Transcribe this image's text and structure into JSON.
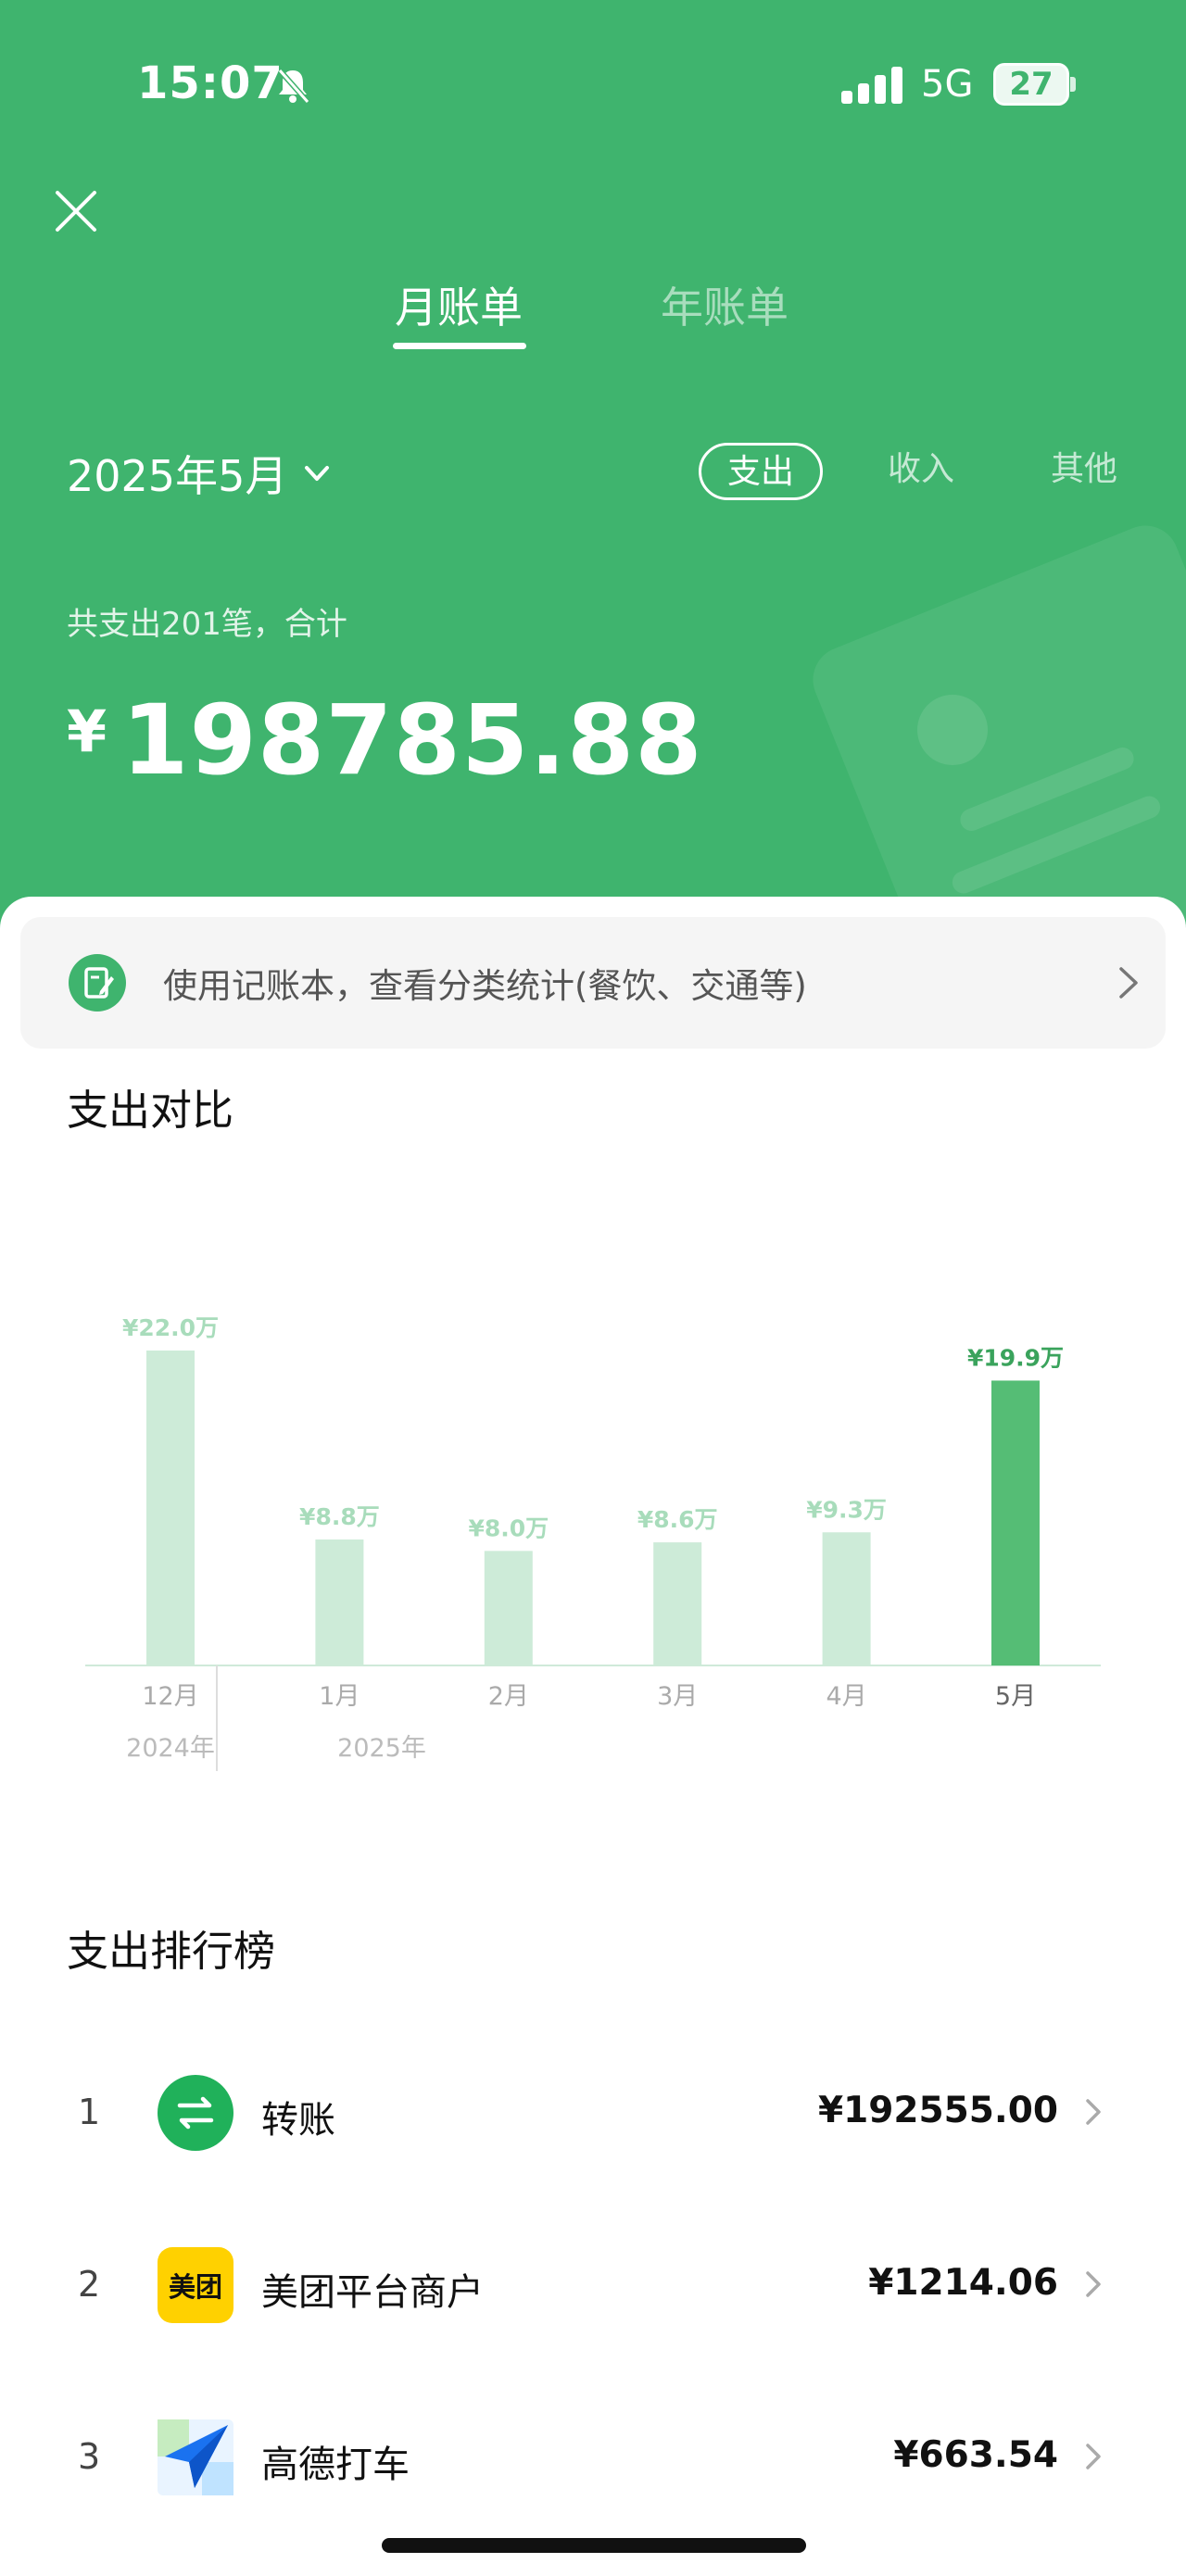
{
  "status_bar": {
    "time": "15:07",
    "network": "5G",
    "battery": "27"
  },
  "header": {
    "tabs": [
      {
        "label": "月账单"
      },
      {
        "label": "年账单"
      }
    ],
    "month_picker": "2025年5月",
    "filters": [
      {
        "label": "支出"
      },
      {
        "label": "收入"
      },
      {
        "label": "其他"
      }
    ],
    "summary_label": "共支出201笔，合计",
    "currency": "¥",
    "total_amount": "198785.88"
  },
  "promo": {
    "text": "使用记账本，查看分类统计(餐饮、交通等)"
  },
  "compare_title": "支出对比",
  "rank_title": "支出排行榜",
  "colors": {
    "brand": "#3fb46e",
    "bar_dim": "#cdebd8",
    "bar_active": "#55bd75",
    "label_dim": "#a8dcbb",
    "label_active": "#3aa35c"
  },
  "chart_data": {
    "type": "bar",
    "categories": [
      "12月",
      "1月",
      "2月",
      "3月",
      "4月",
      "5月"
    ],
    "year_labels": [
      "2024年",
      "2025年"
    ],
    "values": [
      22.0,
      8.8,
      8.0,
      8.6,
      9.3,
      19.9
    ],
    "value_labels": [
      "¥22.0万",
      "¥8.8万",
      "¥8.0万",
      "¥8.6万",
      "¥9.3万",
      "¥19.9万"
    ],
    "highlight_index": 5,
    "unit": "万",
    "ylim": [
      0,
      22.0
    ],
    "grid": false
  },
  "ranking": [
    {
      "rank": "1",
      "name": "转账",
      "amount": "¥192555.00",
      "icon": "transfer-icon"
    },
    {
      "rank": "2",
      "name": "美团平台商户",
      "amount": "¥1214.06",
      "icon": "meituan-logo",
      "logo_text": "美团"
    },
    {
      "rank": "3",
      "name": "高德打车",
      "amount": "¥663.54",
      "icon": "amap-taxi-logo"
    }
  ]
}
